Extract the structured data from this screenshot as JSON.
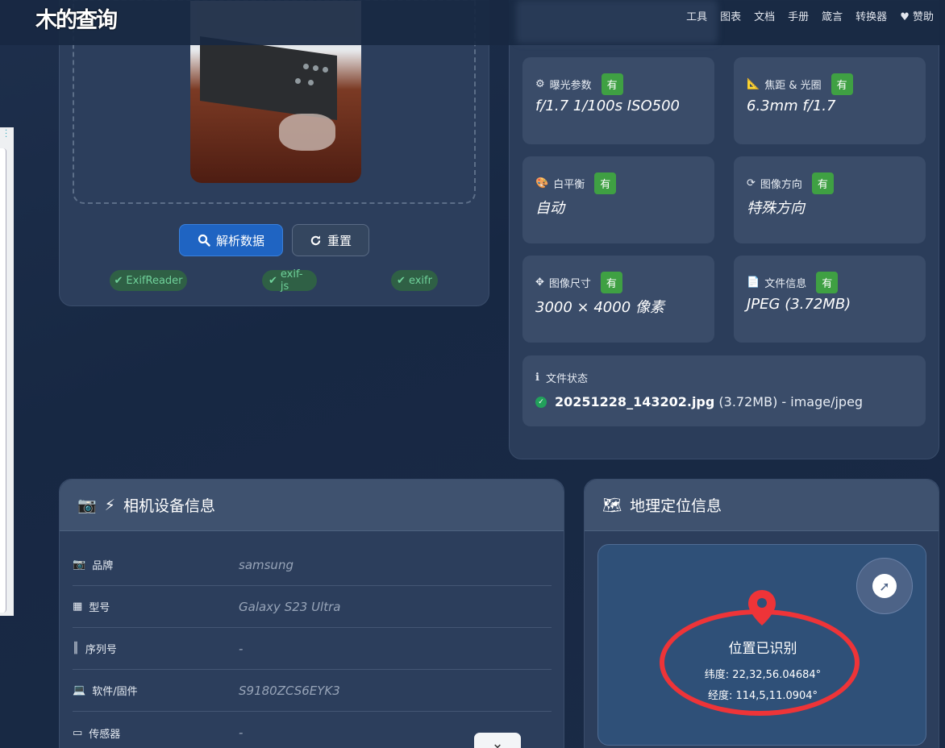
{
  "nav": {
    "logo_text": "木的查询",
    "links": [
      "工具",
      "图表",
      "文档",
      "手册",
      "箴言",
      "转换器"
    ],
    "sponsor_label": "赞助"
  },
  "upload": {
    "parse_button": "解析数据",
    "reset_button": "重置",
    "libraries": [
      "ExifReader",
      "exif-js",
      "exifr"
    ]
  },
  "exif_cards": [
    {
      "label": "曝光参数",
      "badge": "有",
      "value": "f/1.7 1/100s ISO500",
      "icon": "gear-icon"
    },
    {
      "label": "焦距 & 光圈",
      "badge": "有",
      "value": "6.3mm f/1.7",
      "icon": "ruler-icon"
    },
    {
      "label": "白平衡",
      "badge": "有",
      "value": "自动",
      "icon": "palette-icon"
    },
    {
      "label": "图像方向",
      "badge": "有",
      "value": "特殊方向",
      "icon": "rotate-icon"
    },
    {
      "label": "图像尺寸",
      "badge": "有",
      "value": "3000 × 4000 像素",
      "icon": "arrows-icon"
    },
    {
      "label": "文件信息",
      "badge": "有",
      "value": "JPEG (3.72MB)",
      "icon": "file-icon"
    }
  ],
  "file_status": {
    "label": "文件状态",
    "filename": "20251228_143202.jpg",
    "details": "(3.72MB) - image/jpeg"
  },
  "device": {
    "title": "相机设备信息",
    "rows": [
      {
        "key": "品牌",
        "value": "samsung",
        "icon": "camera-icon"
      },
      {
        "key": "型号",
        "value": "Galaxy S23 Ultra",
        "icon": "chip-icon"
      },
      {
        "key": "序列号",
        "value": "-",
        "icon": "barcode-icon"
      },
      {
        "key": "软件/固件",
        "value": "S9180ZCS6EYK3",
        "icon": "laptop-icon"
      },
      {
        "key": "传感器",
        "value": "-",
        "icon": "hdd-icon"
      }
    ]
  },
  "geo": {
    "title": "地理定位信息",
    "status": "位置已识别",
    "latitude": "纬度: 22,32,56.04684°",
    "longitude": "经度: 114,5,11.0904°"
  },
  "colors": {
    "accent": "#1f64c2",
    "badge": "#3fa043",
    "highlight_ring": "#ee3438"
  }
}
